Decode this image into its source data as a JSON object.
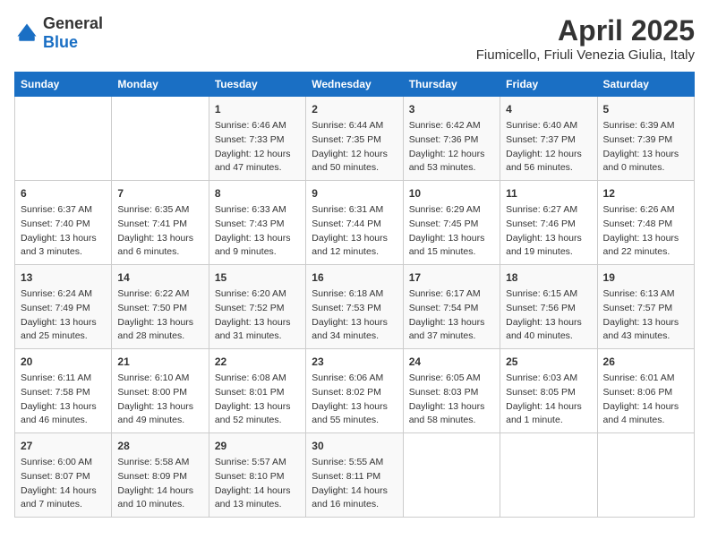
{
  "logo": {
    "general": "General",
    "blue": "Blue"
  },
  "title": "April 2025",
  "subtitle": "Fiumicello, Friuli Venezia Giulia, Italy",
  "days_of_week": [
    "Sunday",
    "Monday",
    "Tuesday",
    "Wednesday",
    "Thursday",
    "Friday",
    "Saturday"
  ],
  "weeks": [
    [
      {
        "day": "",
        "empty": true
      },
      {
        "day": "",
        "empty": true
      },
      {
        "day": "1",
        "sunrise": "6:46 AM",
        "sunset": "7:33 PM",
        "daylight": "12 hours and 47 minutes."
      },
      {
        "day": "2",
        "sunrise": "6:44 AM",
        "sunset": "7:35 PM",
        "daylight": "12 hours and 50 minutes."
      },
      {
        "day": "3",
        "sunrise": "6:42 AM",
        "sunset": "7:36 PM",
        "daylight": "12 hours and 53 minutes."
      },
      {
        "day": "4",
        "sunrise": "6:40 AM",
        "sunset": "7:37 PM",
        "daylight": "12 hours and 56 minutes."
      },
      {
        "day": "5",
        "sunrise": "6:39 AM",
        "sunset": "7:39 PM",
        "daylight": "13 hours and 0 minutes."
      }
    ],
    [
      {
        "day": "6",
        "sunrise": "6:37 AM",
        "sunset": "7:40 PM",
        "daylight": "13 hours and 3 minutes."
      },
      {
        "day": "7",
        "sunrise": "6:35 AM",
        "sunset": "7:41 PM",
        "daylight": "13 hours and 6 minutes."
      },
      {
        "day": "8",
        "sunrise": "6:33 AM",
        "sunset": "7:43 PM",
        "daylight": "13 hours and 9 minutes."
      },
      {
        "day": "9",
        "sunrise": "6:31 AM",
        "sunset": "7:44 PM",
        "daylight": "13 hours and 12 minutes."
      },
      {
        "day": "10",
        "sunrise": "6:29 AM",
        "sunset": "7:45 PM",
        "daylight": "13 hours and 15 minutes."
      },
      {
        "day": "11",
        "sunrise": "6:27 AM",
        "sunset": "7:46 PM",
        "daylight": "13 hours and 19 minutes."
      },
      {
        "day": "12",
        "sunrise": "6:26 AM",
        "sunset": "7:48 PM",
        "daylight": "13 hours and 22 minutes."
      }
    ],
    [
      {
        "day": "13",
        "sunrise": "6:24 AM",
        "sunset": "7:49 PM",
        "daylight": "13 hours and 25 minutes."
      },
      {
        "day": "14",
        "sunrise": "6:22 AM",
        "sunset": "7:50 PM",
        "daylight": "13 hours and 28 minutes."
      },
      {
        "day": "15",
        "sunrise": "6:20 AM",
        "sunset": "7:52 PM",
        "daylight": "13 hours and 31 minutes."
      },
      {
        "day": "16",
        "sunrise": "6:18 AM",
        "sunset": "7:53 PM",
        "daylight": "13 hours and 34 minutes."
      },
      {
        "day": "17",
        "sunrise": "6:17 AM",
        "sunset": "7:54 PM",
        "daylight": "13 hours and 37 minutes."
      },
      {
        "day": "18",
        "sunrise": "6:15 AM",
        "sunset": "7:56 PM",
        "daylight": "13 hours and 40 minutes."
      },
      {
        "day": "19",
        "sunrise": "6:13 AM",
        "sunset": "7:57 PM",
        "daylight": "13 hours and 43 minutes."
      }
    ],
    [
      {
        "day": "20",
        "sunrise": "6:11 AM",
        "sunset": "7:58 PM",
        "daylight": "13 hours and 46 minutes."
      },
      {
        "day": "21",
        "sunrise": "6:10 AM",
        "sunset": "8:00 PM",
        "daylight": "13 hours and 49 minutes."
      },
      {
        "day": "22",
        "sunrise": "6:08 AM",
        "sunset": "8:01 PM",
        "daylight": "13 hours and 52 minutes."
      },
      {
        "day": "23",
        "sunrise": "6:06 AM",
        "sunset": "8:02 PM",
        "daylight": "13 hours and 55 minutes."
      },
      {
        "day": "24",
        "sunrise": "6:05 AM",
        "sunset": "8:03 PM",
        "daylight": "13 hours and 58 minutes."
      },
      {
        "day": "25",
        "sunrise": "6:03 AM",
        "sunset": "8:05 PM",
        "daylight": "14 hours and 1 minute."
      },
      {
        "day": "26",
        "sunrise": "6:01 AM",
        "sunset": "8:06 PM",
        "daylight": "14 hours and 4 minutes."
      }
    ],
    [
      {
        "day": "27",
        "sunrise": "6:00 AM",
        "sunset": "8:07 PM",
        "daylight": "14 hours and 7 minutes."
      },
      {
        "day": "28",
        "sunrise": "5:58 AM",
        "sunset": "8:09 PM",
        "daylight": "14 hours and 10 minutes."
      },
      {
        "day": "29",
        "sunrise": "5:57 AM",
        "sunset": "8:10 PM",
        "daylight": "14 hours and 13 minutes."
      },
      {
        "day": "30",
        "sunrise": "5:55 AM",
        "sunset": "8:11 PM",
        "daylight": "14 hours and 16 minutes."
      },
      {
        "day": "",
        "empty": true
      },
      {
        "day": "",
        "empty": true
      },
      {
        "day": "",
        "empty": true
      }
    ]
  ]
}
